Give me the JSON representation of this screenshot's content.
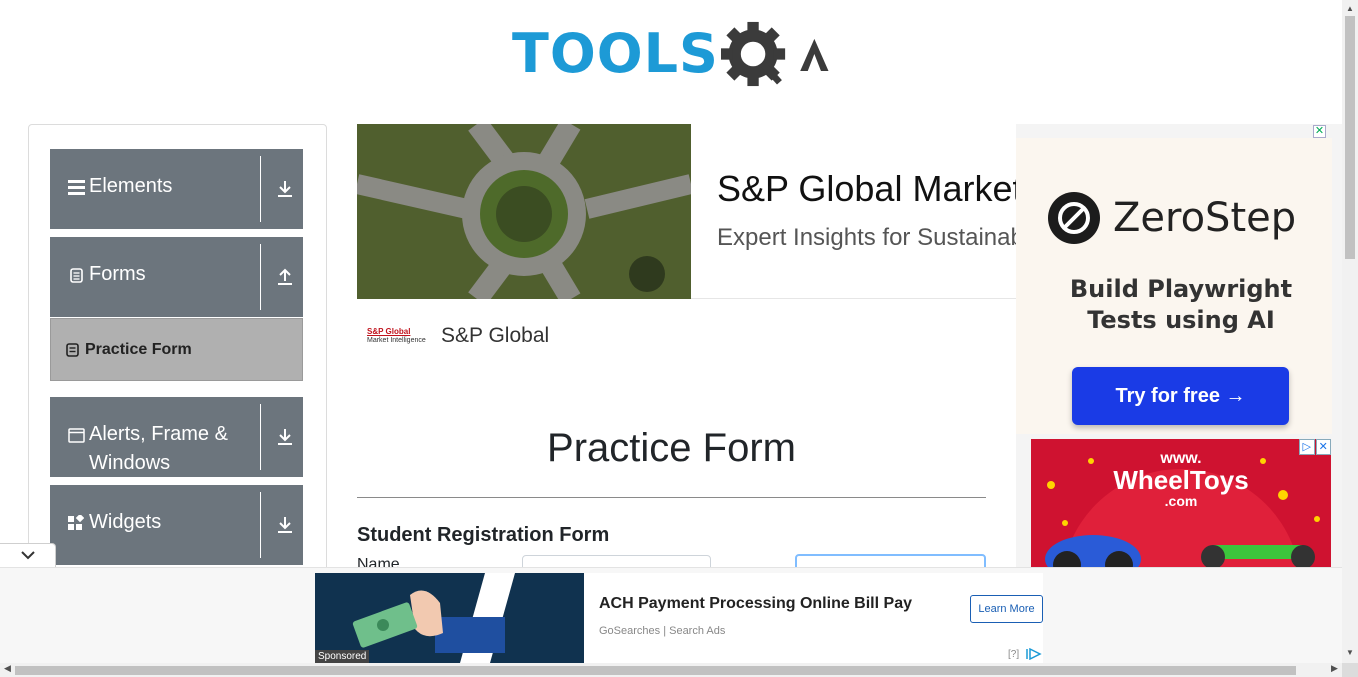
{
  "header": {
    "logo_text": "TOOLS",
    "logo_suffix": "QA"
  },
  "sidebar": {
    "groups": [
      {
        "label": "Elements",
        "icon": "list-icon",
        "arrow": "download-icon"
      },
      {
        "label": "Forms",
        "icon": "document-icon",
        "arrow": "upload-icon"
      },
      {
        "label": "Alerts, Frame & Windows",
        "icon": "window-icon",
        "arrow": "download-icon"
      },
      {
        "label": "Widgets",
        "icon": "widgets-icon",
        "arrow": "download-icon"
      }
    ],
    "active_item": {
      "label": "Practice Form",
      "icon": "form-icon"
    }
  },
  "center_ad": {
    "headline": "S&P Global Market",
    "subline": "Expert Insights for Sustainab",
    "brand_logo_line1": "S&P Global",
    "brand_logo_line2": "Market Intelligence",
    "brand_name": "S&P Global"
  },
  "main": {
    "page_title": "Practice Form",
    "form_title": "Student Registration Form",
    "name_label": "Name"
  },
  "right_ads": {
    "zerostep": {
      "brand": "ZeroStep",
      "tagline": "Build Playwright Tests using AI",
      "cta": "Try for free →"
    },
    "wheeltoys": {
      "line1": "www.",
      "line2": "WheelToys",
      "line3": ".com"
    }
  },
  "bottom_ad": {
    "title": "ACH Payment Processing Online Bill Pay",
    "source": "GoSearches | Search Ads",
    "cta": "Learn More",
    "sponsored": "Sponsored",
    "info": "[?]"
  },
  "colors": {
    "brand_blue": "#1d9ad6",
    "sidebar_group_bg": "#6c757d",
    "active_item_bg": "#b0b0b0",
    "focus_border": "#80bdff"
  }
}
